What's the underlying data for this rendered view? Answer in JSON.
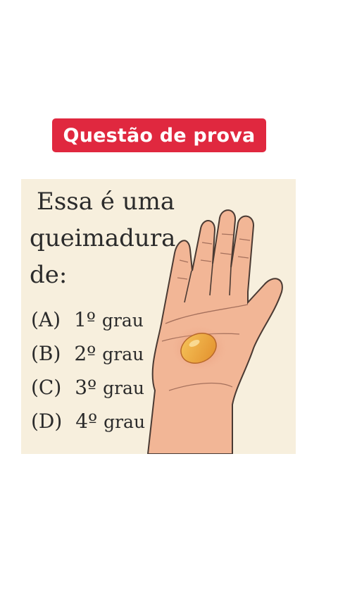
{
  "badge": {
    "label": "Questão de prova",
    "color": "#e0283f"
  },
  "question": {
    "line1": "Essa é uma",
    "line2": "queimadura",
    "line3": "de:"
  },
  "options": [
    {
      "letter": "(A)",
      "number": "1º",
      "unit": "grau"
    },
    {
      "letter": "(B)",
      "number": "2º",
      "unit": "grau"
    },
    {
      "letter": "(C)",
      "number": "3º",
      "unit": "grau"
    },
    {
      "letter": "(D)",
      "number": "4º",
      "unit": "grau"
    }
  ],
  "illustration": {
    "subject": "hand-palm-with-burn-blister",
    "skin_color": "#f2b696",
    "blister_color": "#e9a23d",
    "background": "#f7efdd"
  }
}
